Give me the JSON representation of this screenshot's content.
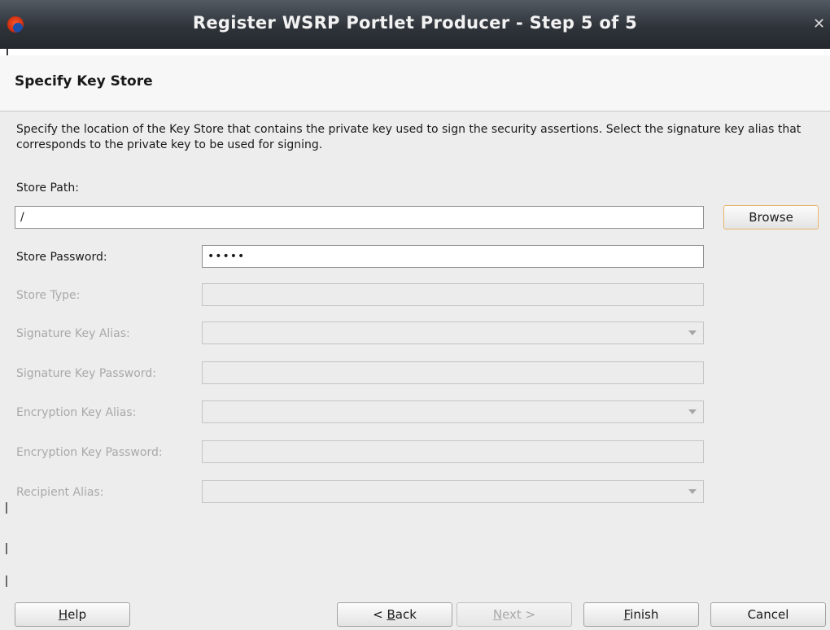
{
  "window": {
    "title": "Register WSRP Portlet Producer - Step 5 of 5",
    "app_icon": "app-icon",
    "close_icon": "close-icon"
  },
  "header": {
    "title": "Specify Key Store"
  },
  "main": {
    "description": "Specify the location of the Key Store that contains the private key used to sign the security assertions. Select the signature key alias that corresponds to the private key to be used for signing.",
    "store_path": {
      "label": "Store Path:",
      "value": "/"
    },
    "browse_label": "Browse",
    "store_password": {
      "label": "Store Password:",
      "value": "•••••"
    },
    "store_type": {
      "label": "Store Type:",
      "value": ""
    },
    "signature_key_alias": {
      "label": "Signature Key Alias:",
      "value": ""
    },
    "signature_key_password": {
      "label": "Signature Key Password:",
      "value": ""
    },
    "encryption_key_alias": {
      "label": "Encryption Key Alias:",
      "value": ""
    },
    "encryption_key_password": {
      "label": "Encryption Key Password:",
      "value": ""
    },
    "recipient_alias": {
      "label": "Recipient Alias:",
      "value": ""
    }
  },
  "footer": {
    "help": {
      "mnemonic": "H",
      "rest": "elp"
    },
    "back": {
      "prefix": "< ",
      "mnemonic": "B",
      "rest": "ack"
    },
    "next": {
      "mnemonic": "N",
      "rest": "ext >"
    },
    "finish": {
      "mnemonic": "F",
      "rest": "inish"
    },
    "cancel": "Cancel"
  }
}
